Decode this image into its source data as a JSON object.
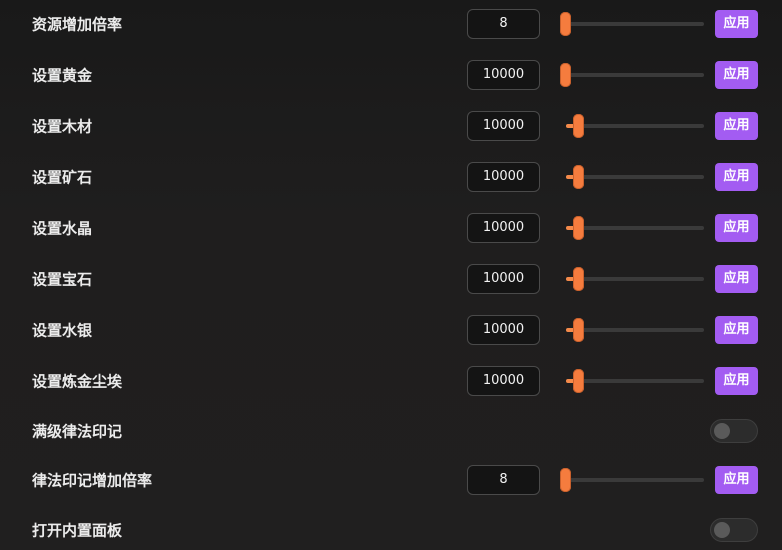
{
  "colors": {
    "background": "#1e1d1d",
    "accent_slider": "#f57c3e",
    "apply_button": "#a35cf2",
    "text": "#ececec"
  },
  "rows": [
    {
      "type": "slider",
      "label": "资源增加倍率",
      "value": "8",
      "slider_fraction": 0.0,
      "button": "应用"
    },
    {
      "type": "slider",
      "label": "设置黄金",
      "value": "10000",
      "slider_fraction": 0.0,
      "button": "应用"
    },
    {
      "type": "slider",
      "label": "设置木材",
      "value": "10000",
      "slider_fraction": 0.1,
      "button": "应用"
    },
    {
      "type": "slider",
      "label": "设置矿石",
      "value": "10000",
      "slider_fraction": 0.1,
      "button": "应用"
    },
    {
      "type": "slider",
      "label": "设置水晶",
      "value": "10000",
      "slider_fraction": 0.1,
      "button": "应用"
    },
    {
      "type": "slider",
      "label": "设置宝石",
      "value": "10000",
      "slider_fraction": 0.1,
      "button": "应用"
    },
    {
      "type": "slider",
      "label": "设置水银",
      "value": "10000",
      "slider_fraction": 0.1,
      "button": "应用"
    },
    {
      "type": "slider",
      "label": "设置炼金尘埃",
      "value": "10000",
      "slider_fraction": 0.1,
      "button": "应用"
    },
    {
      "type": "toggle",
      "label": "满级律法印记",
      "on": false
    },
    {
      "type": "slider",
      "label": "律法印记增加倍率",
      "value": "8",
      "slider_fraction": 0.0,
      "button": "应用"
    },
    {
      "type": "toggle",
      "label": "打开内置面板",
      "on": false
    }
  ]
}
